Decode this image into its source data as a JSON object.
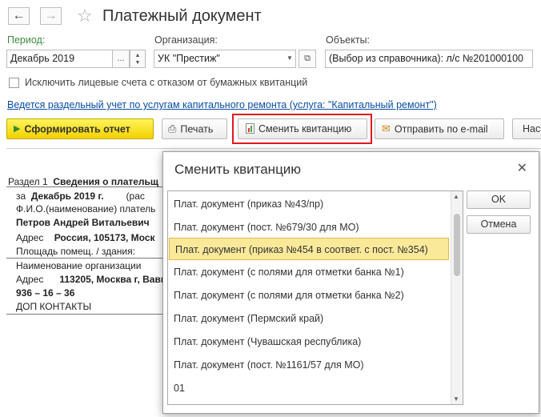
{
  "window": {
    "title": "Платежный документ"
  },
  "filters": {
    "period_label": "Период:",
    "period_value": "Декабрь 2019",
    "period_btn": "...",
    "org_label": "Организация:",
    "org_value": "УК \"Престиж\"",
    "objects_label": "Объекты:",
    "objects_value": "(Выбор из справочника): л/с №201000100"
  },
  "checkbox_label": "Исключить лицевые счета с отказом от бумажных квитанций",
  "info_link": "Ведется раздельный учет по услугам капитального ремонта (услуга: \"Капитальный ремонт\")",
  "toolbar": {
    "generate": "Сформировать отчет",
    "print": "Печать",
    "change_receipt": "Сменить квитанцию",
    "send_email": "Отправить по e-mail",
    "more": "Нас"
  },
  "document": {
    "section": "Раздел 1",
    "section_title": "Сведения о плательщ",
    "for_label": "за",
    "period": "Декабрь 2019 г.",
    "period_suffix": "(рас",
    "payer_label": "Ф.И.О.(наименование) платель",
    "payer_name": "Петров Андрей Витальевич",
    "address_label": "Адрес",
    "address_value": "Россия, 105173, Моск",
    "area_label": "Площадь помещ. / здания:",
    "org_name_label": "Наименование организации",
    "org_address_label": "Адрес",
    "org_address_value": "113205, Москва г, Вавь",
    "phone": "936 – 16 – 36",
    "contacts": "ДОП КОНТАКТЫ"
  },
  "dialog": {
    "title": "Сменить квитанцию",
    "items": [
      "Плат. документ (приказ №43/пр)",
      "Плат. документ (пост. №679/30 для МО)",
      "Плат. документ (приказ №454 в соответ. с пост. №354)",
      "Плат. документ (с полями для отметки банка №1)",
      "Плат. документ (с полями для отметки банка №2)",
      "Плат. документ (Пермский край)",
      "Плат. документ (Чувашская республика)",
      "Плат. документ (пост. №1161/57 для МО)",
      "01"
    ],
    "selected_index": 2,
    "ok": "OK",
    "cancel": "Отмена"
  }
}
